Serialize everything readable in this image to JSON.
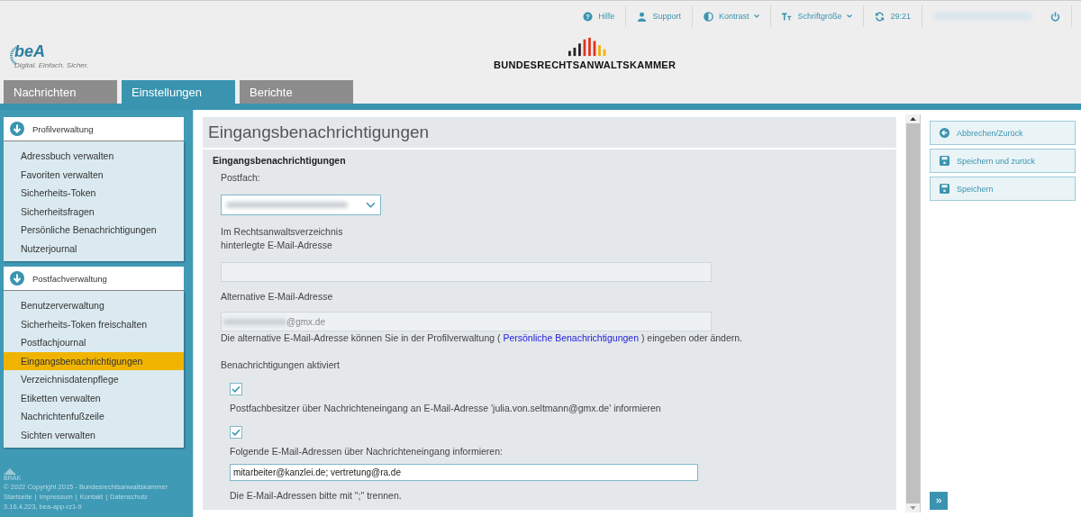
{
  "topbar": {
    "help_glyph": "?",
    "items": [
      {
        "label": "Hilfe",
        "dropdown": false
      },
      {
        "label": "Support",
        "dropdown": false
      },
      {
        "label": "Kontrast",
        "dropdown": true
      },
      {
        "label": "Schriftgröße",
        "dropdown": true
      },
      {
        "label": "29:21",
        "dropdown": false
      }
    ]
  },
  "logo": {
    "name": "beA",
    "tagline": "Digital. Einfach. Sicher."
  },
  "brand": {
    "name": "BUNDESRECHTSANWALTSKAMMER"
  },
  "tabs": [
    {
      "label": "Nachrichten",
      "selected": false
    },
    {
      "label": "Einstellungen",
      "selected": true
    },
    {
      "label": "Berichte",
      "selected": false
    }
  ],
  "sidebar": {
    "groups": [
      {
        "title": "Profilverwaltung",
        "items": [
          {
            "label": "Adressbuch verwalten",
            "selected": false
          },
          {
            "label": "Favoriten verwalten",
            "selected": false
          },
          {
            "label": "Sicherheits-Token",
            "selected": false
          },
          {
            "label": "Sicherheitsfragen",
            "selected": false
          },
          {
            "label": "Persönliche Benachrichtigungen",
            "selected": false
          },
          {
            "label": "Nutzerjournal",
            "selected": false
          }
        ]
      },
      {
        "title": "Postfachverwaltung",
        "items": [
          {
            "label": "Benutzerverwaltung",
            "selected": false
          },
          {
            "label": "Sicherheits-Token freischalten",
            "selected": false
          },
          {
            "label": "Postfachjournal",
            "selected": false
          },
          {
            "label": "Eingangsbenachrichtigungen",
            "selected": true
          },
          {
            "label": "Verzeichnisdatenpflege",
            "selected": false
          },
          {
            "label": "Etiketten verwalten",
            "selected": false
          },
          {
            "label": "Nachrichtenfußzeile",
            "selected": false
          },
          {
            "label": "Sichten verwalten",
            "selected": false
          }
        ]
      }
    ]
  },
  "footer": {
    "org": "BRAK",
    "copyright": "© 2022 Copyright 2015 - Bundesrechtsanwaltskammer",
    "links": [
      "Startseite",
      "Impressum",
      "Kontakt",
      "Datenschutz"
    ],
    "separator": "|",
    "version": "3.16.4.223, bea-app-rz1-9"
  },
  "page": {
    "title": "Eingangsbenachrichtigungen",
    "section": "Eingangsbenachrichtigungen",
    "postfach_label": "Postfach:",
    "registry_email_label": [
      "Im Rechtsanwaltsverzeichnis",
      "hinterlegte E-Mail-Adresse"
    ],
    "alt_email_label": "Alternative E-Mail-Adresse",
    "alt_email_value": "@gmx.de",
    "alt_hint_before": "Die alternative E-Mail-Adresse können Sie in der Profilverwaltung (",
    "alt_hint_link": "Persönliche Benachrichtigungen",
    "alt_hint_after": ") eingeben oder ändern.",
    "activated_label": "Benachrichtigungen aktiviert",
    "options": [
      {
        "label": "Postfachbesitzer über Nachrichteneingang an E-Mail-Adresse 'julia.von.seltmann@gmx.de' informieren",
        "checked": true
      },
      {
        "label": "Folgende E-Mail-Adressen über Nachrichteneingang informieren:",
        "checked": true
      }
    ],
    "recipients_value": "mitarbeiter@kanzlei.de; vertretung@ra.de",
    "recipients_hint": "Die E-Mail-Adressen bitte mit \";\" trennen."
  },
  "actions": [
    {
      "label": "Abbrechen/Zurück"
    },
    {
      "label": "Speichern und zurück"
    },
    {
      "label": "Speichern"
    }
  ]
}
